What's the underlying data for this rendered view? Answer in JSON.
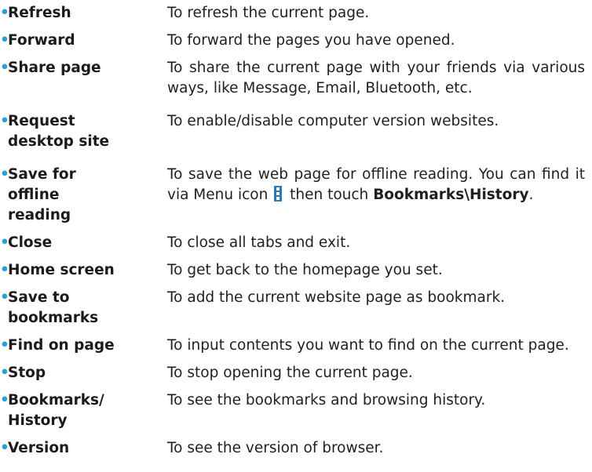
{
  "bullet_char": "•",
  "items": [
    {
      "term": "Refresh",
      "desc": "To refresh the current page."
    },
    {
      "term": "Forward",
      "desc": "To forward the pages you have opened."
    },
    {
      "term": "Share page",
      "desc": "To share the current page with your friends via various ways, like Message, Email, Bluetooth, etc."
    },
    {
      "term": "Request desktop site",
      "desc": "To enable/disable computer version websites."
    },
    {
      "term": "Save for offline reading",
      "desc_before": "To save the web page for offline reading. You can find it via Menu icon",
      "desc_middle": "then touch",
      "desc_bold": "Bookmarks\\History",
      "desc_after": ".",
      "icon": "menu-more-icon"
    },
    {
      "term": "Close",
      "desc": "To close all tabs and exit."
    },
    {
      "term": "Home screen",
      "desc": "To get back to the homepage you set."
    },
    {
      "term": "Save to bookmarks",
      "desc": "To add the current website page as bookmark."
    },
    {
      "term": "Find on page",
      "desc": "To input contents you want to find on the current page."
    },
    {
      "term": "Stop",
      "desc": "To stop opening the current page."
    },
    {
      "term": "Bookmarks/ History",
      "desc": "To see the bookmarks and browsing history."
    },
    {
      "term": "Version",
      "desc": "To see the version of browser."
    }
  ],
  "colors": {
    "bullet": "#2a9fd8",
    "icon": "#2a79b8"
  }
}
